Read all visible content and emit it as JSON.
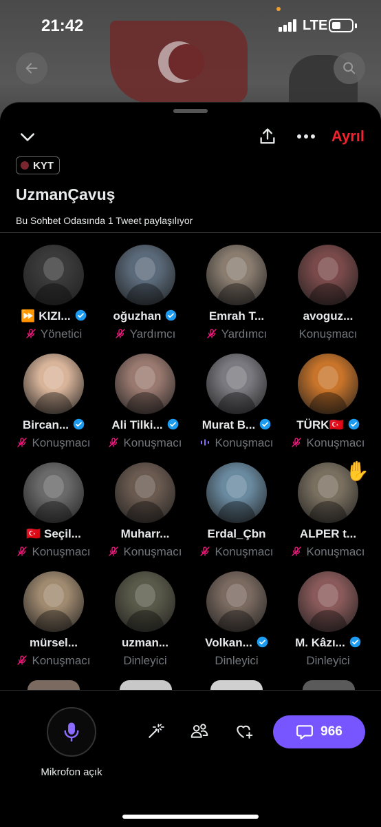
{
  "status": {
    "time": "21:42",
    "network": "LTE"
  },
  "room": {
    "leave_label": "Ayrıl",
    "tag": "KYT",
    "title": "UzmanÇavuş",
    "subtitle": "Bu Sohbet Odasında 1 Tweet paylaşılıyor"
  },
  "colors": {
    "accent": "#7856ff",
    "leave": "#f4212e",
    "verified": "#1d9bf0",
    "muted_icon": "#f91880",
    "role_text": "#71767b"
  },
  "participants": [
    {
      "name": "⏩ KIZI...",
      "verified": true,
      "role": "Yönetici",
      "mic": "off",
      "avatar_color": "#3a3a3a"
    },
    {
      "name": "oğuzhan",
      "verified": true,
      "role": "Yardımcı",
      "mic": "off",
      "avatar_color": "#5b6a7a"
    },
    {
      "name": "Emrah T...",
      "verified": false,
      "role": "Yardımcı",
      "mic": "off",
      "avatar_color": "#8a7d70"
    },
    {
      "name": "avoguz...",
      "verified": false,
      "role": "Konuşmacı",
      "mic": "none",
      "avatar_color": "#7a4a4a"
    },
    {
      "name": "Bircan...",
      "verified": true,
      "role": "Konuşmacı",
      "mic": "off",
      "avatar_color": "#d8b49a"
    },
    {
      "name": "Ali Tilki...",
      "verified": true,
      "role": "Konuşmacı",
      "mic": "off",
      "avatar_color": "#9a7a70"
    },
    {
      "name": "Murat B...",
      "verified": true,
      "role": "Konuşmacı",
      "mic": "speaking",
      "avatar_color": "#7a7a80"
    },
    {
      "name": "TÜRK🇹🇷",
      "verified": true,
      "role": "Konuşmacı",
      "mic": "off",
      "avatar_color": "#c8742a"
    },
    {
      "name": "🇹🇷 Seçil...",
      "verified": false,
      "role": "Konuşmacı",
      "mic": "off",
      "avatar_color": "#6a6a6a"
    },
    {
      "name": "Muharr...",
      "verified": false,
      "role": "Konuşmacı",
      "mic": "off",
      "avatar_color": "#6a5a50"
    },
    {
      "name": "Erdal_Çbn",
      "verified": false,
      "role": "Konuşmacı",
      "mic": "off",
      "avatar_color": "#6a8aa0"
    },
    {
      "name": "ALPER t...",
      "verified": false,
      "role": "Konuşmacı",
      "mic": "off",
      "avatar_color": "#7a7060",
      "hand": "✋"
    },
    {
      "name": "mürsel...",
      "verified": false,
      "role": "Konuşmacı",
      "mic": "off",
      "avatar_color": "#a08a70"
    },
    {
      "name": "uzman...",
      "verified": false,
      "role": "Dinleyici",
      "mic": "none",
      "avatar_color": "#5a5a4a"
    },
    {
      "name": "Volkan...",
      "verified": true,
      "role": "Dinleyici",
      "mic": "none",
      "avatar_color": "#7a6a60"
    },
    {
      "name": "M. Kâzı...",
      "verified": true,
      "role": "Dinleyici",
      "mic": "none",
      "avatar_color": "#8a5a5a"
    }
  ],
  "bottom": {
    "mic_label": "Mikrofon açık",
    "comment_count": "966"
  }
}
